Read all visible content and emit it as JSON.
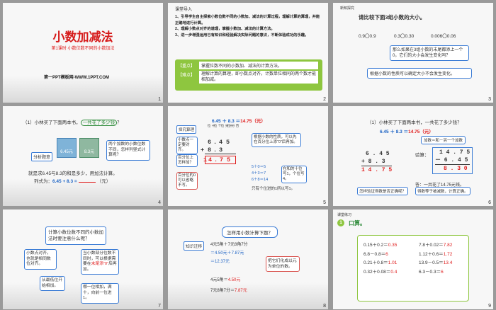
{
  "slide1": {
    "title": "小数加减法",
    "subtitle": "第1课时 小数位数不同的小数加法",
    "brand": "第一PPT模板网-WWW.1PPT.COM",
    "num": "1"
  },
  "slide2": {
    "header": "课堂导入",
    "items": [
      "1、引导学生自主探索小数位数不同的小数加、减法的计算过程，理解计算的算理，并能正确地进行计算。",
      "2、理解小数点对齐的道理，掌握小数加、减法的计算方法。",
      "3、进一步增强运用已有知识和经验解决实际问题的意识，不断体验成功的乐趣。"
    ],
    "key_label": "【重点】",
    "key_text": "掌握位数不同的小数加、减法的计算方法。",
    "diff_label": "【难点】",
    "diff_text": "理解计算的算理，即小数点对齐，计数单位相同的两个数才能相加减。",
    "num": "2"
  },
  "slide3": {
    "header": "新知探究",
    "title": "请比较下面3组小数的大小。",
    "pairs": [
      "0.9〇0.9",
      "0.3〇0.30",
      "0.006〇0.06"
    ],
    "bubble1": "那么如果在3组小数的末尾都添上一个0，它们的大小会发生变化吗？",
    "bubble2": "根据小数的性质可以确定大小不会发生变化。",
    "num": "3"
  },
  "slide4": {
    "question": "（1）小林买了下面两本书，",
    "question_hl": "一共花了多少钱",
    "question_end": "？",
    "price1": "6.45元",
    "price2": "8.3元",
    "analyze": "分析题意",
    "bubble": "两个加数的小数位数不同，怎样列竖式计算呢？",
    "line1": "就是求6.45与8.3的和是多少，用加法计算。",
    "line2_pre": "列式为：",
    "line2_expr": "6.45 + 8.3 =",
    "line2_unit": "（元）",
    "num": "4"
  },
  "slide5": {
    "formula": "6.45 ＋ 8.3 ＝",
    "result": "14.75（元）",
    "tags": [
      "探究算理",
      "小数点一定要对齐。",
      "百分位上怎样加？",
      "百分位的0可以省略不写。"
    ],
    "columns": [
      "十位",
      "个位",
      "十分位",
      "百分位"
    ],
    "row1": [
      "6",
      ".",
      "4",
      "5"
    ],
    "row2_plus": "+",
    "row2": [
      "8",
      ".",
      "3",
      ""
    ],
    "result_digits": [
      "1",
      "4",
      ".",
      "7",
      "5"
    ],
    "note1": "根据小数的性质，可以先在百分位上添“0”后再加。",
    "note2": "在和的十位写1，个位写4。",
    "sums": [
      "5＋0＝5",
      "4＋3＝7",
      "6＋8＝14"
    ],
    "sum_tail": "只有个位进的1所以写1。",
    "num": "5"
  },
  "slide6": {
    "question": "（1）小林买了下面两本书，一共花了多少钱？",
    "formula": "6.45 ＋ 8.3 ＝",
    "result": "14.75（元）",
    "add_top": "6 . 4 5",
    "add_mid": "+ 8 . 3",
    "add_res": "1 4 . 7 5",
    "check_label": "验算：",
    "check_note": "加数＝和－另一个加数",
    "sub_top": "1 4 . 7 5",
    "sub_mid": "－ 6 . 4 5",
    "sub_res": "8 . 3 0",
    "answer": "答：一共花了14.75元钱。",
    "q2": "怎样验证得数是否正确呢？",
    "a2": "得数等于被减数，计算正确。",
    "num": "6"
  },
  "slide7": {
    "q": "计算小数位数不同的小数加法时要注意什么呢？",
    "b1": "小数点对齐，也就是相同数位对齐。",
    "b2_pre": "当小数部分位数不同时，可以根据需要在",
    "b2_hl": "末尾添“0”",
    "b2_post": "后再加。",
    "b3": "从最低位开始相加。",
    "b4": "哪一位相加，满十，向前一位进1。",
    "num": "7"
  },
  "slide8": {
    "title": "怎样用小数计算下题？",
    "tag": "知识迁移",
    "l1": "4元5角＋7元8角7分",
    "l2": "＝4.50元＋7.87元",
    "l3": "＝12.37元",
    "bubble": "把它们化成以元为单位的数。",
    "l4_pre": "4元5角＝",
    "l4_val": "4.50元",
    "l5_pre": "7元8角7分＝",
    "l5_val": "7.87元",
    "num": "8"
  },
  "slide9": {
    "header": "课堂练习",
    "badge": "1",
    "title": "口算。",
    "rows": [
      {
        "a": "0.15＋0.2＝",
        "av": "0.35",
        "b": "7.8＋0.02＝",
        "bv": "7.82"
      },
      {
        "a": "6.8－0.8＝",
        "av": "6",
        "b": "1.12＋0.6＝",
        "bv": "1.72"
      },
      {
        "a": "0.21＋0.8＝",
        "av": "1.01",
        "b": "13.9－0.5＝",
        "bv": "13.4"
      },
      {
        "a": "0.32＋0.08＝",
        "av": "0.4",
        "b": "6.3－0.3＝",
        "bv": "6"
      }
    ],
    "num": "9"
  }
}
